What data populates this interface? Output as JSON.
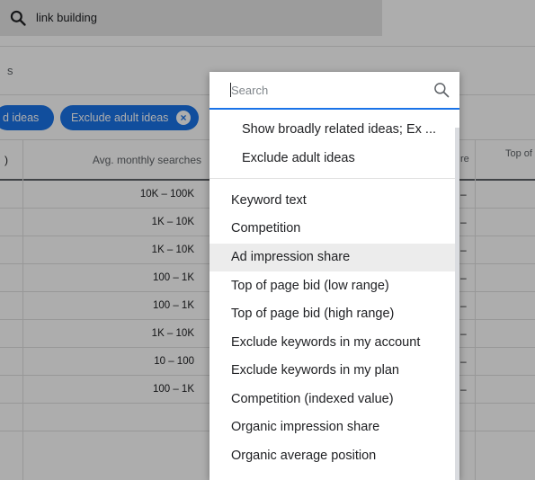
{
  "search": {
    "query": "link building"
  },
  "section": {
    "label": "s"
  },
  "filters": [
    {
      "label": "d ideas"
    },
    {
      "label": "Exclude adult ideas"
    }
  ],
  "table": {
    "headers": [
      ")",
      "Avg. monthly searches",
      "re",
      "Top of"
    ],
    "rows": [
      {
        "searches": "10K – 100K",
        "col3": "–"
      },
      {
        "searches": "1K – 10K",
        "col3": "–"
      },
      {
        "searches": "1K – 10K",
        "col3": "–"
      },
      {
        "searches": "100 – 1K",
        "col3": "–"
      },
      {
        "searches": "100 – 1K",
        "col3": "–"
      },
      {
        "searches": "1K – 10K",
        "col3": "–"
      },
      {
        "searches": "10 – 100",
        "col3": "–"
      },
      {
        "searches": "100 – 1K",
        "col3": "–"
      },
      {
        "searches": "",
        "col3": ""
      }
    ]
  },
  "dropdown": {
    "search_placeholder": "Search",
    "pinned_items": [
      {
        "label": "Show broadly related ideas; Ex ..."
      },
      {
        "label": "Exclude adult ideas"
      }
    ],
    "items": [
      {
        "label": "Keyword text"
      },
      {
        "label": "Competition"
      },
      {
        "label": "Ad impression share",
        "highlighted": true
      },
      {
        "label": "Top of page bid (low range)"
      },
      {
        "label": "Top of page bid (high range)"
      },
      {
        "label": "Exclude keywords in my account"
      },
      {
        "label": "Exclude keywords in my plan"
      },
      {
        "label": "Competition (indexed value)"
      },
      {
        "label": "Organic impression share"
      },
      {
        "label": "Organic average position"
      }
    ]
  },
  "colors": {
    "accent": "#1a73e8",
    "highlight": "#ececec"
  }
}
